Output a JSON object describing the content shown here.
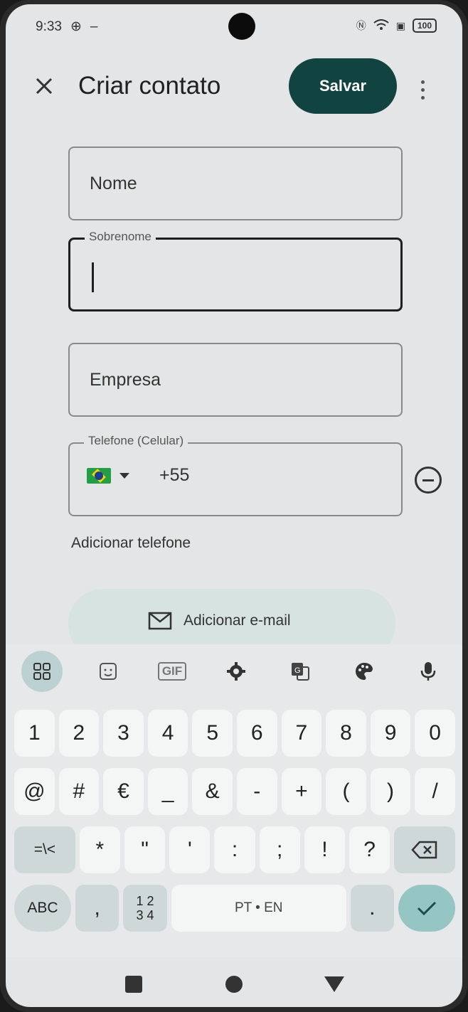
{
  "status_bar": {
    "time": "9:33",
    "battery": "100"
  },
  "app_bar": {
    "title": "Criar contato",
    "save_label": "Salvar"
  },
  "fields": {
    "name_placeholder": "Nome",
    "surname_label": "Sobrenome",
    "company_placeholder": "Empresa",
    "phone_label": "Telefone (Celular)",
    "phone_prefix": "+55"
  },
  "links": {
    "add_phone": "Adicionar telefone",
    "add_email": "Adicionar e-mail"
  },
  "keyboard": {
    "tools": [
      "apps-grid-icon",
      "sticker-icon",
      "gif-icon",
      "settings-icon",
      "translate-icon",
      "palette-icon",
      "mic-icon"
    ],
    "gif_label": "GIF",
    "row1": [
      "1",
      "2",
      "3",
      "4",
      "5",
      "6",
      "7",
      "8",
      "9",
      "0"
    ],
    "row2": [
      "@",
      "#",
      "€",
      "_",
      "&",
      "-",
      "+",
      "(",
      ")",
      "/"
    ],
    "row3": [
      "=\\<",
      "*",
      "\"",
      "'",
      ":",
      ";",
      "!",
      "?"
    ],
    "abc": "ABC",
    "comma": ",",
    "numsym_top": "1 2",
    "numsym_bottom": "3 4",
    "space": "PT • EN",
    "period": "."
  }
}
